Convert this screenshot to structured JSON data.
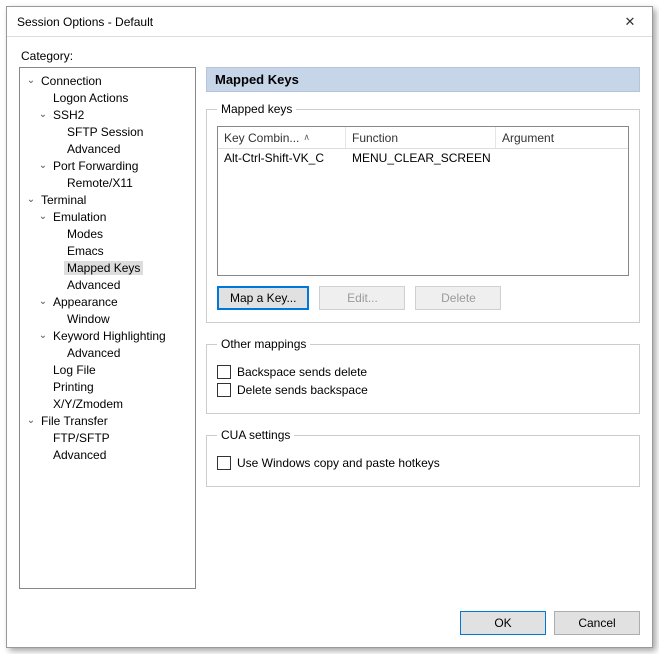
{
  "window": {
    "title": "Session Options - Default",
    "close_icon": "✕"
  },
  "category_label": "Category:",
  "tree": [
    {
      "label": "Connection",
      "level": 0,
      "exp": true,
      "sel": false,
      "children": true
    },
    {
      "label": "Logon Actions",
      "level": 1,
      "exp": false,
      "sel": false,
      "children": false
    },
    {
      "label": "SSH2",
      "level": 1,
      "exp": true,
      "sel": false,
      "children": true
    },
    {
      "label": "SFTP Session",
      "level": 2,
      "exp": false,
      "sel": false,
      "children": false
    },
    {
      "label": "Advanced",
      "level": 2,
      "exp": false,
      "sel": false,
      "children": false
    },
    {
      "label": "Port Forwarding",
      "level": 1,
      "exp": true,
      "sel": false,
      "children": true
    },
    {
      "label": "Remote/X11",
      "level": 2,
      "exp": false,
      "sel": false,
      "children": false
    },
    {
      "label": "Terminal",
      "level": 0,
      "exp": true,
      "sel": false,
      "children": true
    },
    {
      "label": "Emulation",
      "level": 1,
      "exp": true,
      "sel": false,
      "children": true
    },
    {
      "label": "Modes",
      "level": 2,
      "exp": false,
      "sel": false,
      "children": false
    },
    {
      "label": "Emacs",
      "level": 2,
      "exp": false,
      "sel": false,
      "children": false
    },
    {
      "label": "Mapped Keys",
      "level": 2,
      "exp": false,
      "sel": true,
      "children": false
    },
    {
      "label": "Advanced",
      "level": 2,
      "exp": false,
      "sel": false,
      "children": false
    },
    {
      "label": "Appearance",
      "level": 1,
      "exp": true,
      "sel": false,
      "children": true
    },
    {
      "label": "Window",
      "level": 2,
      "exp": false,
      "sel": false,
      "children": false
    },
    {
      "label": "Keyword Highlighting",
      "level": 1,
      "exp": true,
      "sel": false,
      "children": true
    },
    {
      "label": "Advanced",
      "level": 2,
      "exp": false,
      "sel": false,
      "children": false
    },
    {
      "label": "Log File",
      "level": 1,
      "exp": false,
      "sel": false,
      "children": false
    },
    {
      "label": "Printing",
      "level": 1,
      "exp": false,
      "sel": false,
      "children": false
    },
    {
      "label": "X/Y/Zmodem",
      "level": 1,
      "exp": false,
      "sel": false,
      "children": false
    },
    {
      "label": "File Transfer",
      "level": 0,
      "exp": true,
      "sel": false,
      "children": true
    },
    {
      "label": "FTP/SFTP",
      "level": 1,
      "exp": false,
      "sel": false,
      "children": false
    },
    {
      "label": "Advanced",
      "level": 1,
      "exp": false,
      "sel": false,
      "children": false
    }
  ],
  "section_title": "Mapped Keys",
  "mapped_keys": {
    "legend": "Mapped keys",
    "columns": {
      "combo": "Key Combin...",
      "func": "Function",
      "arg": "Argument"
    },
    "rows": [
      {
        "combo": "Alt-Ctrl-Shift-VK_C",
        "func": "MENU_CLEAR_SCREEN",
        "arg": ""
      }
    ],
    "buttons": {
      "map": "Map a Key...",
      "edit": "Edit...",
      "delete": "Delete"
    }
  },
  "other_mappings": {
    "legend": "Other mappings",
    "backspace": "Backspace sends delete",
    "delete": "Delete sends backspace"
  },
  "cua": {
    "legend": "CUA settings",
    "winhotkeys": "Use Windows copy and paste hotkeys"
  },
  "footer": {
    "ok": "OK",
    "cancel": "Cancel"
  }
}
